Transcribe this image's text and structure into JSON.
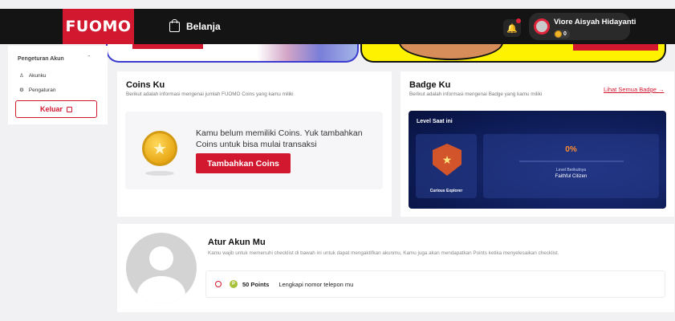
{
  "header": {
    "logo": "FUOMO",
    "shop_label": "Belanja",
    "user_name": "Viore Aisyah Hidayanti",
    "user_coins": "0"
  },
  "sidebar": {
    "section_title": "Pengeturan Akun",
    "items": [
      {
        "label": "Akunku",
        "icon": "user-icon"
      },
      {
        "label": "Pengaturan",
        "icon": "gear-icon"
      }
    ],
    "logout_label": "Keluar"
  },
  "coins": {
    "title": "Coins Ku",
    "subtitle": "Berikut adalah informasi mengenai jumlah FUOMO Coins yang kamu miliki",
    "message": "Kamu belum memiliki Coins. Yuk tambahkan Coins untuk bisa mulai transaksi",
    "button_label": "Tambahkan Coins"
  },
  "badge": {
    "title": "Badge Ku",
    "subtitle": "Berikut adalah informasi mengenai Badge yang kamu miliki",
    "link_label": "Lihat Semua Badge →",
    "level_title": "Level Saat ini",
    "current_badge": "Curious Explorer",
    "progress_text": "0%",
    "progress_value": 0,
    "next_label": "Level Berikutnya",
    "next_name": "Faithful Citizen"
  },
  "account": {
    "title": "Atur Akun Mu",
    "subtitle": "Kamu wajib untuk memenuhi checklist di bawah ini untuk dapat mengaktifkan akunmu, Kamu juga akan mendapatkan Points ketika menyelesaikan checklist.",
    "checklist": [
      {
        "points": "50 Points",
        "task": "Lengkapi nomor telepon mu"
      }
    ]
  },
  "colors": {
    "brand_red": "#d2182f",
    "topbar": "#141414",
    "level_bg": "#0c1a52",
    "progress_orange": "#ff8c30"
  }
}
